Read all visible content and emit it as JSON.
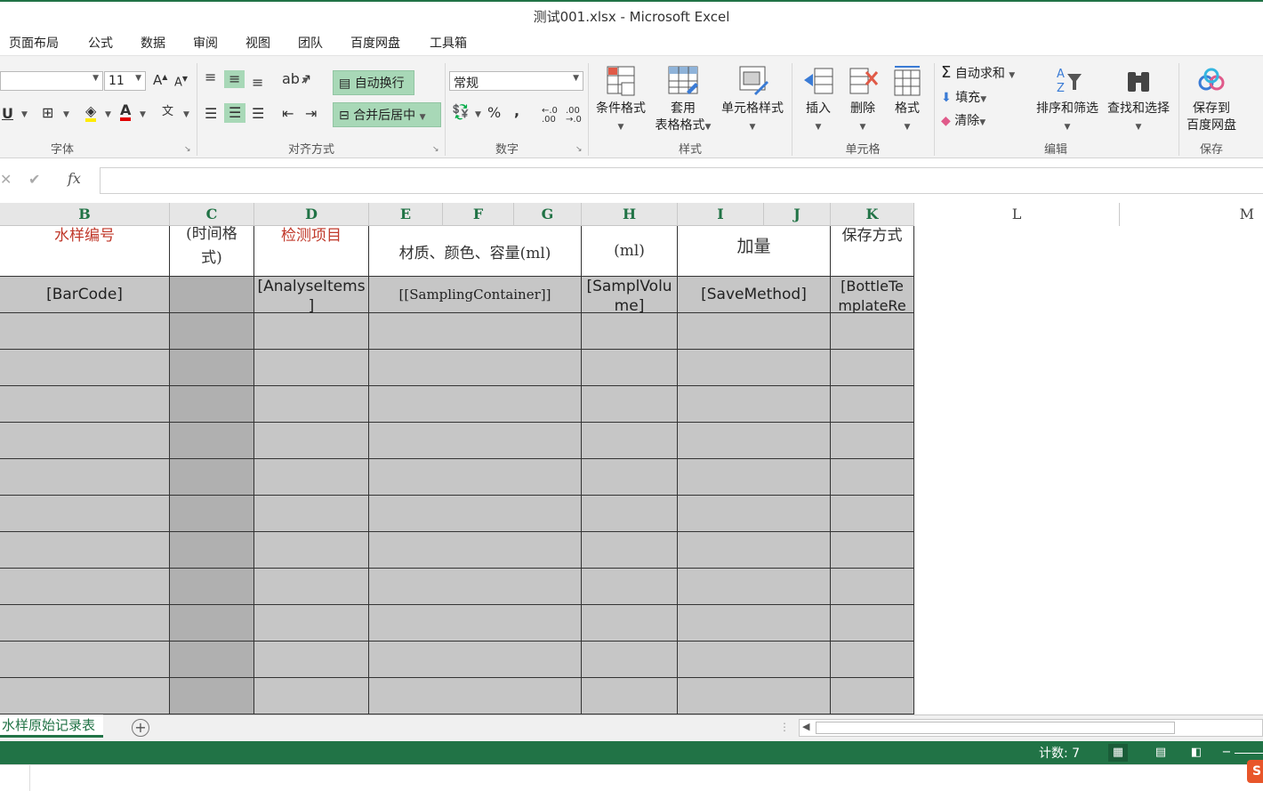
{
  "window": {
    "title": "测试001.xlsx - Microsoft Excel"
  },
  "menu": [
    "页面布局",
    "公式",
    "数据",
    "审阅",
    "视图",
    "团队",
    "百度网盘",
    "工具箱"
  ],
  "ribbon": {
    "font": {
      "size": "11",
      "label": "字体"
    },
    "alignment": {
      "wrap_label": "自动换行",
      "merge_label": "合并后居中",
      "label": "对齐方式"
    },
    "number": {
      "format": "常规",
      "label": "数字",
      "percent": "%",
      "comma": ","
    },
    "styles": {
      "conditional": "条件格式",
      "table_1": "套用",
      "table_2": "表格格式",
      "cell_styles": "单元格样式",
      "label": "样式"
    },
    "cells": {
      "insert": "插入",
      "delete": "删除",
      "format": "格式",
      "label": "单元格"
    },
    "editing": {
      "autosum": "自动求和",
      "fill": "填充",
      "clear": "清除",
      "sort": "排序和筛选",
      "find": "查找和选择",
      "label": "编辑"
    },
    "save": {
      "line1": "保存到",
      "line2": "百度网盘",
      "label": "保存"
    }
  },
  "formula": {
    "fx": "fx"
  },
  "columns": [
    "B",
    "C",
    "D",
    "E",
    "F",
    "G",
    "H",
    "I",
    "J",
    "K",
    "L",
    "M"
  ],
  "header_row": {
    "b": "水样编号",
    "c1": "(时间格",
    "c2": "式)",
    "d": "检测项目",
    "efg": "材质、颜色、容量(ml)",
    "h": "(ml)",
    "ij": "加量",
    "k": "保存方式"
  },
  "field_row": {
    "b": "[BarCode]",
    "d1": "[AnalyseItems",
    "d2": "]",
    "efg": "[[SamplingContainer]]",
    "h1": "[SamplVolu",
    "h2": "me]",
    "ij": "[SaveMethod]",
    "k1": "[BottleTe",
    "k2": "mplateRe"
  },
  "sheet": {
    "tab": "水样原始记录表"
  },
  "status": {
    "count": "计数: 7"
  },
  "colors": {
    "accent": "#217346",
    "selection": "#c6c6c6",
    "highlight": "#a8d8b7",
    "header_red": "#c0392b"
  }
}
